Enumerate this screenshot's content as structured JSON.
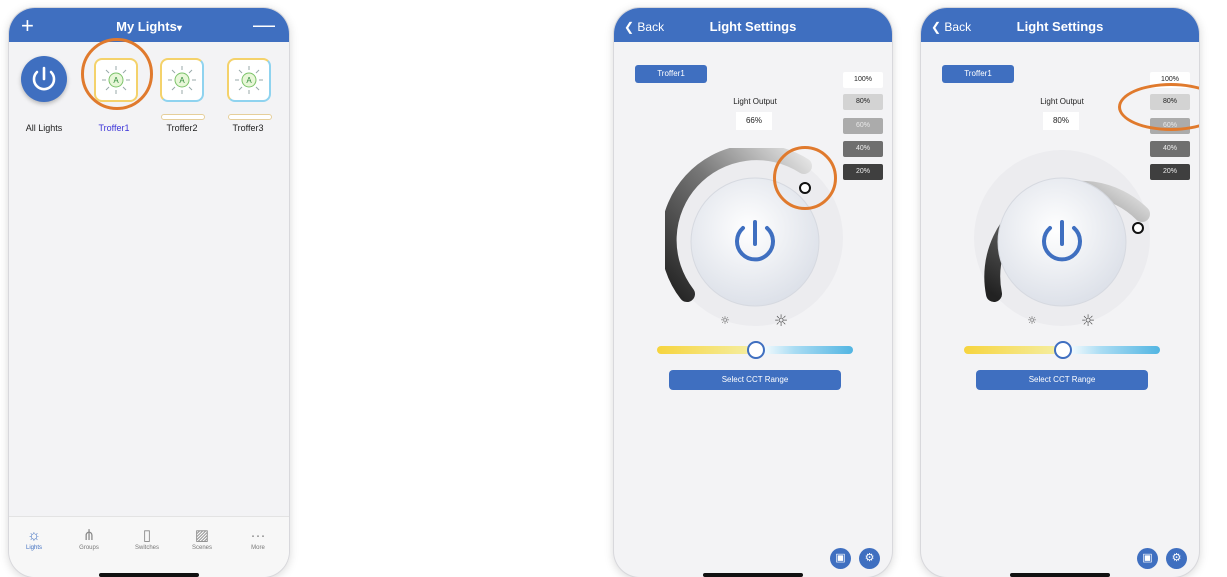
{
  "screens": {
    "my_lights": {
      "title": "My Lights",
      "title_caret": "▾",
      "plus_label": "+",
      "minus_label": "—",
      "all_lights_label": "All Lights",
      "fixtures": [
        {
          "label": "Troffer1",
          "selected": true
        },
        {
          "label": "Troffer2",
          "selected": false
        },
        {
          "label": "Troffer3",
          "selected": false
        }
      ],
      "tabs": [
        {
          "label": "Lights",
          "icon": "sun-icon",
          "active": true
        },
        {
          "label": "Groups",
          "icon": "groups-icon",
          "active": false
        },
        {
          "label": "Switches",
          "icon": "switch-icon",
          "active": false
        },
        {
          "label": "Scenes",
          "icon": "scenes-icon",
          "active": false
        },
        {
          "label": "More",
          "icon": "more-icon",
          "active": false
        }
      ]
    },
    "settings_a": {
      "back_label": "Back",
      "title": "Light Settings",
      "fixture_name": "Troffer1",
      "output_label": "Light Output",
      "output_value": "66%",
      "presets": [
        "100%",
        "80%",
        "60%",
        "40%",
        "20%"
      ],
      "dial_level": 0.66,
      "cct_position": 0.5,
      "cct_button": "Select CCT Range"
    },
    "settings_b": {
      "back_label": "Back",
      "title": "Light Settings",
      "fixture_name": "Troffer1",
      "output_label": "Light Output",
      "output_value": "80%",
      "presets": [
        "100%",
        "80%",
        "60%",
        "40%",
        "20%"
      ],
      "dial_level": 0.8,
      "cct_position": 0.5,
      "cct_button": "Select CCT Range"
    }
  },
  "colors": {
    "header_blue": "#3f6fc0",
    "highlight_orange": "#e07a2d",
    "selected_label_blue": "#3d35d9"
  }
}
